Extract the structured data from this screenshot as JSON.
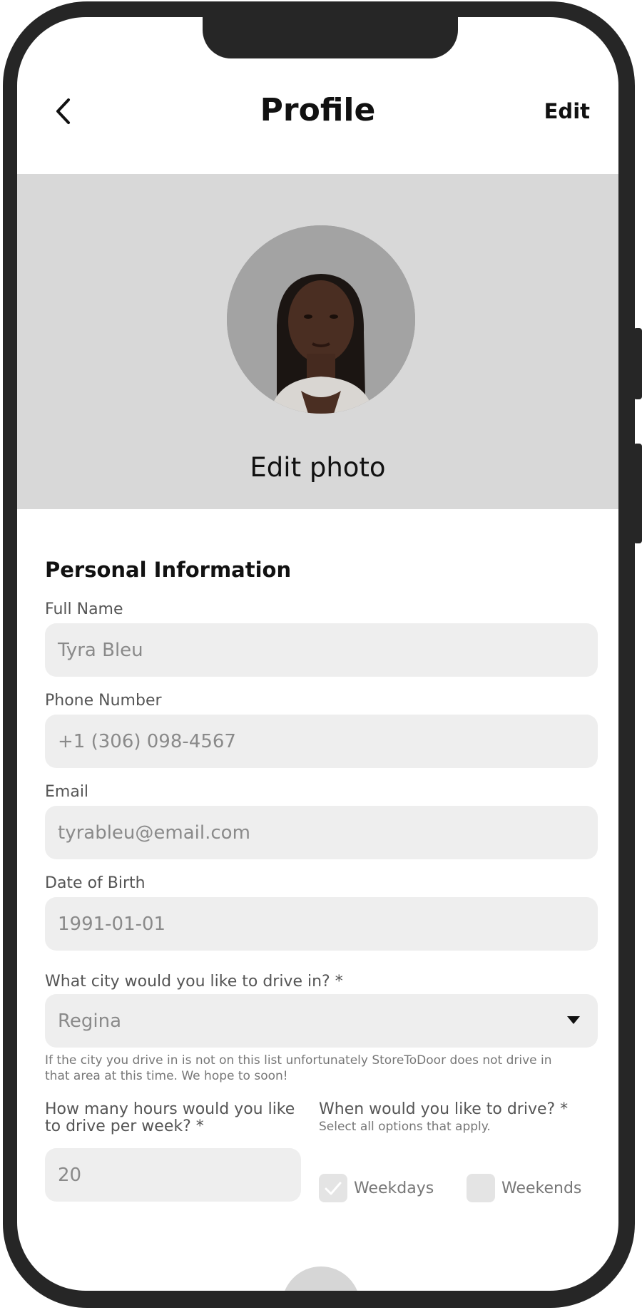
{
  "header": {
    "title": "Profile",
    "edit_label": "Edit"
  },
  "photo": {
    "edit_label": "Edit photo"
  },
  "form": {
    "section_title": "Personal Information",
    "full_name": {
      "label": "Full Name",
      "value": "Tyra Bleu"
    },
    "phone": {
      "label": "Phone Number",
      "value": "+1 (306) 098-4567"
    },
    "email": {
      "label": "Email",
      "value": "tyrableu@email.com"
    },
    "dob": {
      "label": "Date of Birth",
      "value": "1991-01-01"
    },
    "city": {
      "label": "What city would you like to drive in? *",
      "selected": "Regina",
      "help_line1": "If the city you drive in is not on this list unfortunately StoreToDoor does not drive in",
      "help_line2": "that area at this time. We hope to soon!"
    },
    "hours": {
      "label_line1": "How many hours would you like",
      "label_line2": "to drive per week? *",
      "value": "20"
    },
    "when": {
      "label": "When would you like to drive? *",
      "sublabel": "Select all options that apply.",
      "options": [
        {
          "label": "Weekdays",
          "checked": true
        },
        {
          "label": "Weekends",
          "checked": false
        }
      ]
    }
  }
}
